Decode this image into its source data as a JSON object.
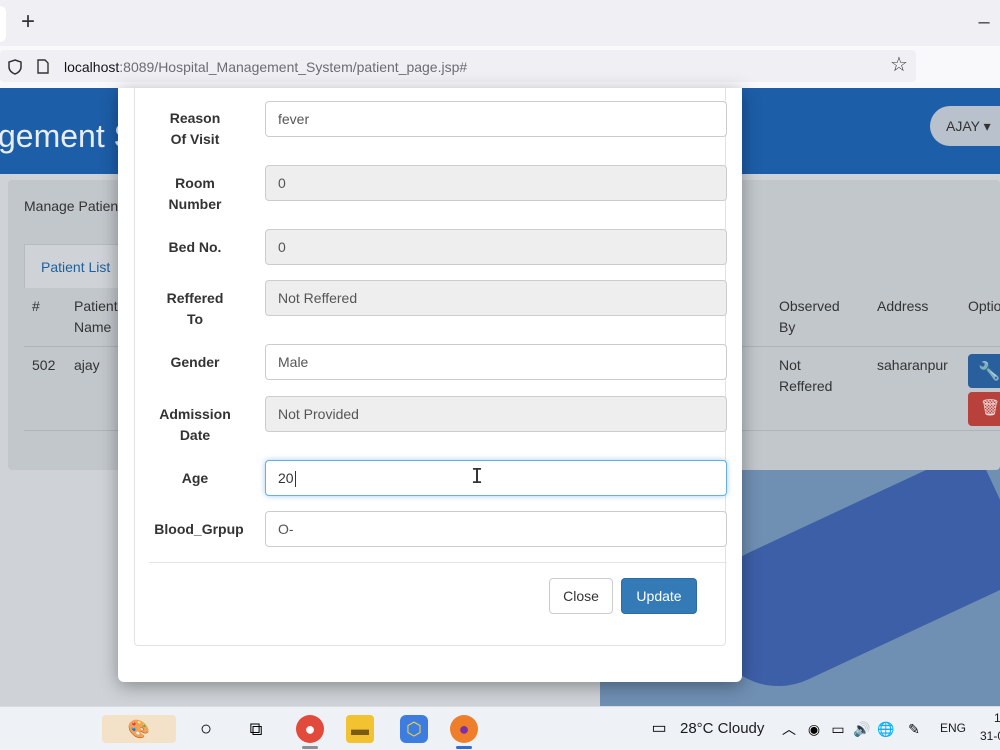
{
  "browser": {
    "url_host": "localhost",
    "url_rest": ":8089/Hospital_Management_System/patient_page.jsp#",
    "new_tab_symbol": "+",
    "minimize_symbol": "–"
  },
  "app": {
    "brand_fragment": "gement S",
    "user_button": "AJAY ▾",
    "breadcrumb": "Manage Patien",
    "tab_label": "Patient List",
    "table": {
      "headers": [
        "#",
        "Patient\nName",
        "Observed\nBy",
        "Address",
        "Optio"
      ],
      "row": {
        "id": "502",
        "name": "ajay",
        "observed_by": "Not\nReffered",
        "address": "saharanpur"
      }
    }
  },
  "modal": {
    "fields": [
      {
        "label": "Reason\nOf Visit",
        "value": "fever",
        "readonly": false
      },
      {
        "label": "Room\nNumber",
        "value": "0",
        "readonly": true
      },
      {
        "label": "Bed No.",
        "value": "0",
        "readonly": true
      },
      {
        "label": "Reffered\nTo",
        "value": "Not Reffered",
        "readonly": true
      },
      {
        "label": "Gender",
        "value": "Male",
        "readonly": false
      },
      {
        "label": "Admission\nDate",
        "value": "Not Provided",
        "readonly": true
      },
      {
        "label": "Age",
        "value": "20",
        "readonly": false
      },
      {
        "label": "Blood_Grpup",
        "value": "O-",
        "readonly": false
      }
    ],
    "close_label": "Close",
    "update_label": "Update"
  },
  "taskbar": {
    "weather": "28°C  Cloudy",
    "language": "ENG",
    "time_fragment": "1",
    "date_fragment": "31-0"
  },
  "colors": {
    "header_blue": "#1d5ea8",
    "primary": "#337ab7",
    "danger": "#b8413c"
  }
}
